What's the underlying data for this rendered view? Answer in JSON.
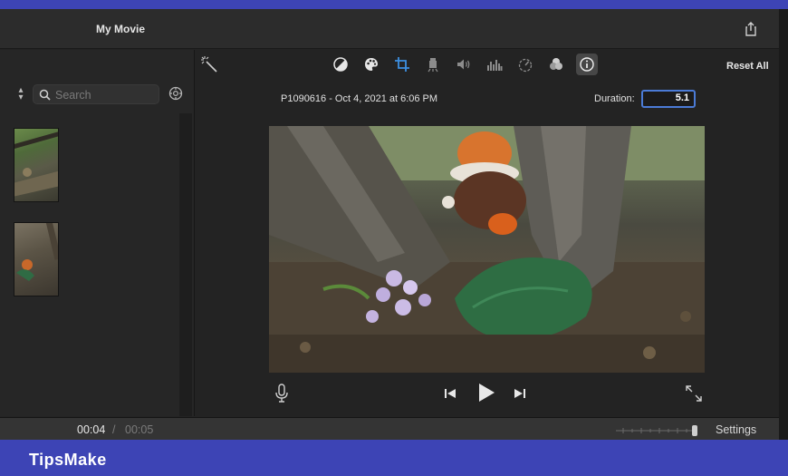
{
  "window": {
    "title": "My Movie"
  },
  "library": {
    "search": {
      "placeholder": "Search",
      "value": ""
    }
  },
  "viewer": {
    "toolbar": {
      "tools": [
        {
          "icon": "color-balance-icon",
          "active": false
        },
        {
          "icon": "color-palette-icon",
          "active": false
        },
        {
          "icon": "crop-icon",
          "active": false
        },
        {
          "icon": "stabilization-icon",
          "active": false
        },
        {
          "icon": "volume-icon",
          "active": false
        },
        {
          "icon": "noise-equalizer-icon",
          "active": false
        },
        {
          "icon": "speed-icon",
          "active": false
        },
        {
          "icon": "clip-filter-icon",
          "active": false
        },
        {
          "icon": "info-icon",
          "active": true
        }
      ],
      "reset_all": "Reset All"
    },
    "clip_info": "P1090616 - Oct 4, 2021 at 6:06 PM",
    "duration_label": "Duration:",
    "duration_value": "5.1"
  },
  "timeline": {
    "current_time": "00:04",
    "separator": "/",
    "total_time": "00:05",
    "settings_label": "Settings"
  },
  "watermark": {
    "brand": "TipsMake"
  },
  "colors": {
    "accent": "#4b7bd6",
    "crop_active": "#3d8fe0",
    "brand_band": "#3d44b5"
  }
}
